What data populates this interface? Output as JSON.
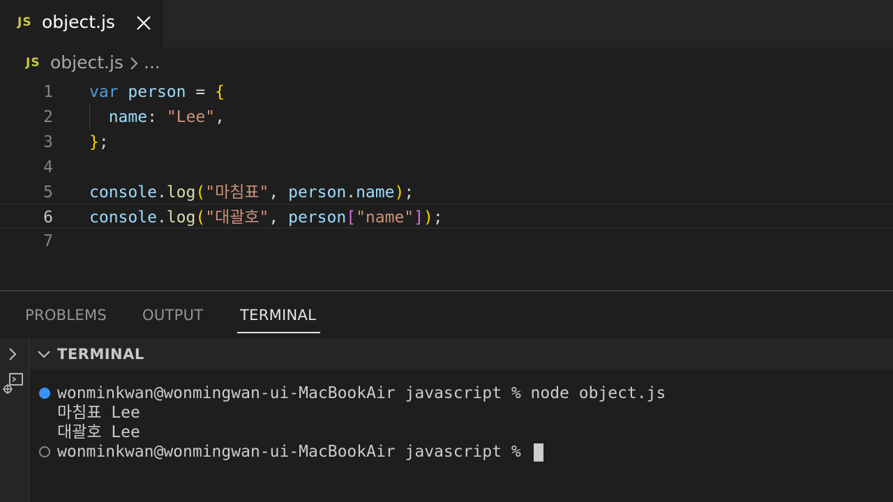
{
  "tab": {
    "icon": "JS",
    "label": "object.js"
  },
  "breadcrumb": {
    "icon": "JS",
    "file": "object.js",
    "more": "..."
  },
  "editor": {
    "lines": [
      {
        "number": "1",
        "text": "var person = {"
      },
      {
        "number": "2",
        "text": "  name: \"Lee\","
      },
      {
        "number": "3",
        "text": "};"
      },
      {
        "number": "4",
        "text": ""
      },
      {
        "number": "5",
        "text": "console.log(\"마침표\", person.name);"
      },
      {
        "number": "6",
        "text": "console.log(\"대괄호\", person[\"name\"]);"
      },
      {
        "number": "7",
        "text": ""
      }
    ],
    "active_line": "6"
  },
  "panel": {
    "tabs": [
      "PROBLEMS",
      "OUTPUT",
      "TERMINAL"
    ],
    "active_tab": "TERMINAL",
    "terminal_title": "TERMINAL"
  },
  "terminal": {
    "lines": [
      "wonminkwan@wonmingwan-ui-MacBookAir javascript % node object.js",
      "마침표 Lee",
      "대괄호 Lee",
      "wonminkwan@wonmingwan-ui-MacBookAir javascript % "
    ]
  },
  "colors": {
    "js_icon": "#cbcb41",
    "accent_blue": "#3794ff"
  }
}
